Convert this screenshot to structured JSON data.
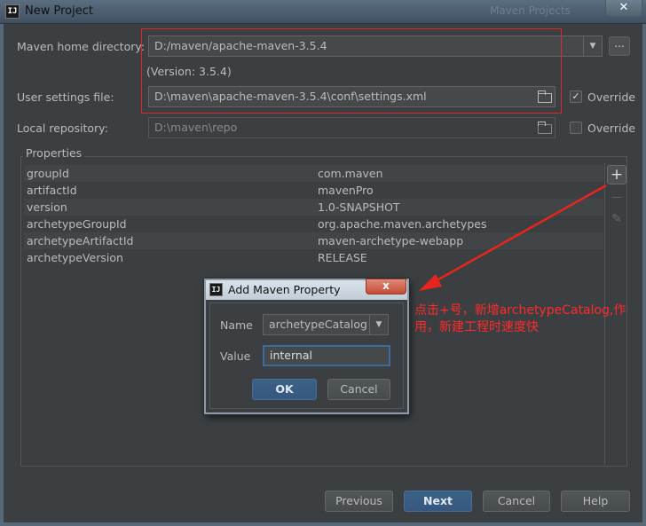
{
  "window": {
    "title": "New Project",
    "ghost_title": "Maven Projects",
    "close_label": "✕",
    "app_icon": "IJ"
  },
  "maven_home": {
    "label": "Maven home directory:",
    "value": "D:/maven/apache-maven-3.5.4",
    "version": "(Version: 3.5.4)",
    "browse_label": "..."
  },
  "user_settings": {
    "label": "User settings file:",
    "value": "D:\\maven\\apache-maven-3.5.4\\conf\\settings.xml",
    "override_label": "Override",
    "override_checked": true,
    "check_mark": "✓"
  },
  "local_repo": {
    "label": "Local repository:",
    "value": "D:\\maven\\repo",
    "override_label": "Override",
    "override_checked": false
  },
  "properties": {
    "title": "Properties",
    "rows": [
      {
        "key": "groupId",
        "value": "com.maven"
      },
      {
        "key": "artifactId",
        "value": "mavenPro"
      },
      {
        "key": "version",
        "value": "1.0-SNAPSHOT"
      },
      {
        "key": "archetypeGroupId",
        "value": "org.apache.maven.archetypes"
      },
      {
        "key": "archetypeArtifactId",
        "value": "maven-archetype-webapp"
      },
      {
        "key": "archetypeVersion",
        "value": "RELEASE"
      }
    ],
    "add_label": "+",
    "remove_label": "—",
    "edit_label": "✎"
  },
  "annotation": {
    "text": "点击+号，新增archetypeCatalog,作用，新建工程时速度快",
    "color": "#ff2a2a"
  },
  "dialog": {
    "title": "Add Maven Property",
    "icon": "IJ",
    "close_label": "x",
    "name_label": "Name",
    "name_value": "archetypeCatalog",
    "value_label": "Value",
    "value_value": "internal",
    "ok_label": "OK",
    "cancel_label": "Cancel"
  },
  "buttons": {
    "previous": "Previous",
    "next": "Next",
    "cancel": "Cancel",
    "help": "Help"
  },
  "colors": {
    "background": "#3c3f41",
    "accent": "#365880",
    "highlight_box": "#e0262b"
  }
}
